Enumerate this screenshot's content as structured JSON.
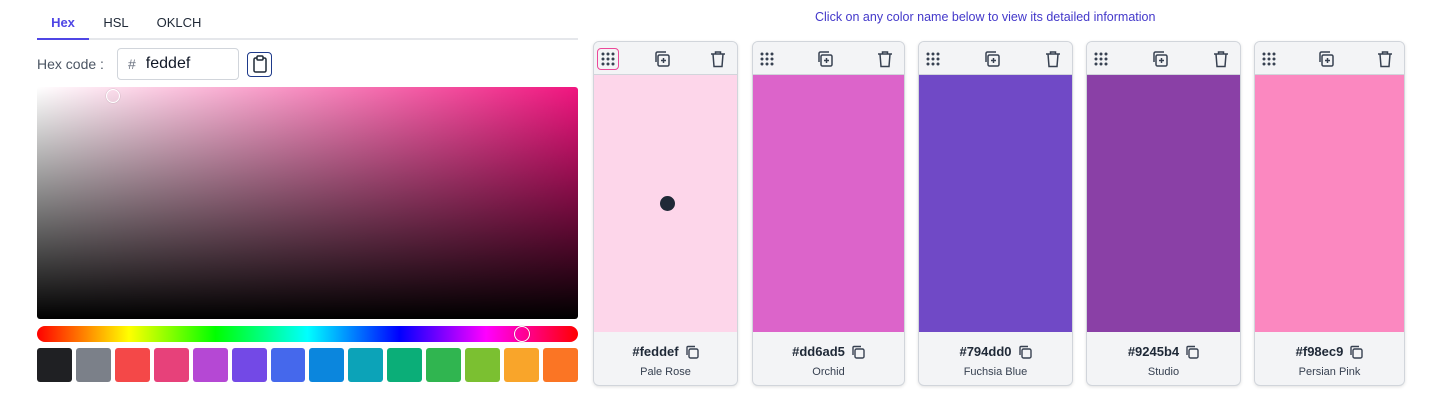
{
  "tabs": [
    "Hex",
    "HSL",
    "OKLCH"
  ],
  "hex_label": "Hex code :",
  "hex_prefix": "#",
  "hex_value": "feddef",
  "hint": "Click on any color name below to view its detailed information",
  "preset_swatches": [
    "#1f2023",
    "#7b8089",
    "#f44848",
    "#e7417a",
    "#b548d4",
    "#7349e6",
    "#4568ec",
    "#0b86dd",
    "#0ca3b8",
    "#0bae78",
    "#30b550",
    "#7bc031",
    "#f9a52a",
    "#fb7524"
  ],
  "palette": [
    {
      "hex": "#feddef",
      "name": "Pale Rose",
      "color": "#fdd6ea"
    },
    {
      "hex": "#dd6ad5",
      "name": "Orchid",
      "color": "#dc64ca"
    },
    {
      "hex": "#794dd0",
      "name": "Fuchsia Blue",
      "color": "#7049c6"
    },
    {
      "hex": "#9245b4",
      "name": "Studio",
      "color": "#8a40a6"
    },
    {
      "hex": "#f98ec9",
      "name": "Persian Pink",
      "color": "#fb88c0"
    }
  ]
}
